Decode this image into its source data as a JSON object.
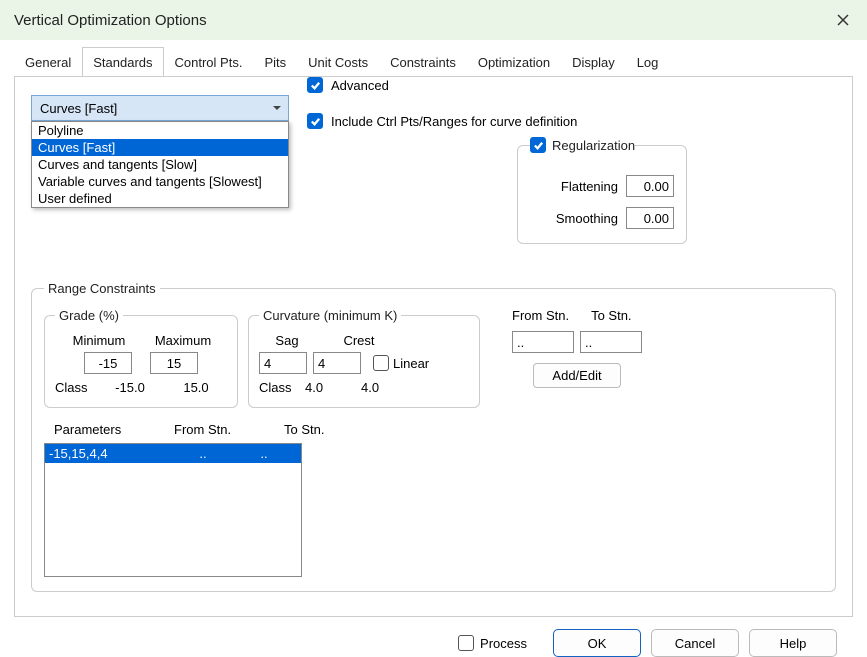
{
  "window": {
    "title": "Vertical Optimization Options"
  },
  "tabs": {
    "items": [
      "General",
      "Standards",
      "Control Pts.",
      "Pits",
      "Unit Costs",
      "Constraints",
      "Optimization",
      "Display",
      "Log"
    ],
    "active": 1
  },
  "select": {
    "value": "Curves [Fast]",
    "options": [
      "Polyline",
      "Curves [Fast]",
      "Curves and tangents [Slow]",
      "Variable curves and tangents [Slowest]",
      "User defined"
    ],
    "selectedIndex": 1
  },
  "checks": {
    "advanced": "Advanced",
    "includeCtrl": "Include Ctrl Pts/Ranges for curve definition",
    "regularization": "Regularization",
    "linear": "Linear",
    "process": "Process"
  },
  "reg": {
    "flatteningLabel": "Flattening",
    "flattening": "0.00",
    "smoothingLabel": "Smoothing",
    "smoothing": "0.00"
  },
  "range": {
    "title": "Range Constraints",
    "grade": {
      "title": "Grade (%)",
      "minLabel": "Minimum",
      "maxLabel": "Maximum",
      "min": "-15",
      "max": "15",
      "classLabel": "Class",
      "classMin": "-15.0",
      "classMax": "15.0"
    },
    "curv": {
      "title": "Curvature (minimum K)",
      "sagLabel": "Sag",
      "crestLabel": "Crest",
      "sag": "4",
      "crest": "4",
      "classLabel": "Class",
      "classSag": "4.0",
      "classCrest": "4.0"
    },
    "stn": {
      "fromLabel": "From Stn.",
      "toLabel": "To Stn.",
      "from": "..",
      "to": "..",
      "addEdit": "Add/Edit"
    },
    "paramsHead": {
      "p": "Parameters",
      "f": "From Stn.",
      "t": "To Stn."
    },
    "paramsRows": [
      {
        "p": "-15,15,4,4",
        "f": "..",
        "t": ".."
      }
    ]
  },
  "footer": {
    "ok": "OK",
    "cancel": "Cancel",
    "help": "Help"
  }
}
